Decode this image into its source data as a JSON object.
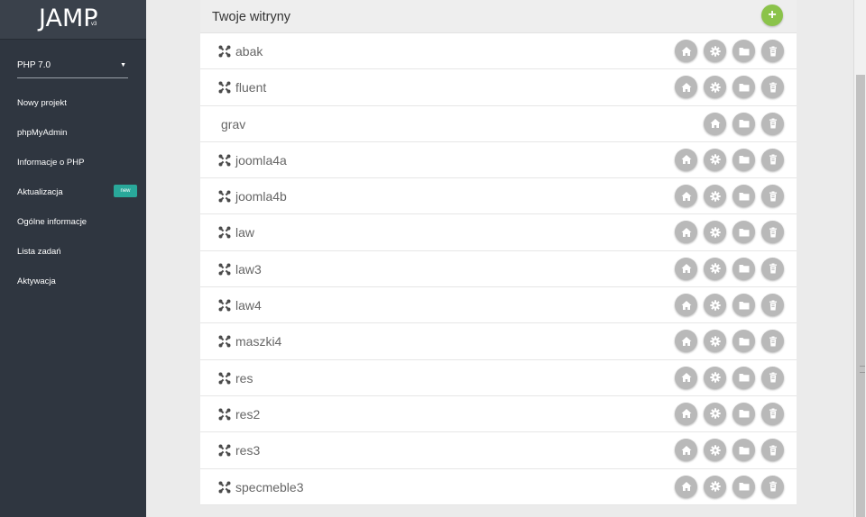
{
  "app": {
    "logo": "JAMP",
    "version": "v3"
  },
  "sidebar": {
    "php_select": {
      "value": "PHP 7.0",
      "arrow": "▼"
    },
    "items": [
      {
        "label": "Nowy projekt",
        "badge": null
      },
      {
        "label": "phpMyAdmin",
        "badge": null
      },
      {
        "label": "Informacje o PHP",
        "badge": null
      },
      {
        "label": "Aktualizacja",
        "badge": "new"
      },
      {
        "label": "Ogólne informacje",
        "badge": null
      },
      {
        "label": "Lista zadań",
        "badge": null
      },
      {
        "label": "Aktywacja",
        "badge": null
      }
    ]
  },
  "panel": {
    "title": "Twoje witryny",
    "add_label": "+",
    "sites": [
      {
        "name": "abak",
        "joomla": true,
        "settings": true
      },
      {
        "name": "fluent",
        "joomla": true,
        "settings": true
      },
      {
        "name": "grav",
        "joomla": false,
        "settings": false
      },
      {
        "name": "joomla4a",
        "joomla": true,
        "settings": true
      },
      {
        "name": "joomla4b",
        "joomla": true,
        "settings": true
      },
      {
        "name": "law",
        "joomla": true,
        "settings": true
      },
      {
        "name": "law3",
        "joomla": true,
        "settings": true
      },
      {
        "name": "law4",
        "joomla": true,
        "settings": true
      },
      {
        "name": "maszki4",
        "joomla": true,
        "settings": true
      },
      {
        "name": "res",
        "joomla": true,
        "settings": true
      },
      {
        "name": "res2",
        "joomla": true,
        "settings": true
      },
      {
        "name": "res3",
        "joomla": true,
        "settings": true
      },
      {
        "name": "specmeble3",
        "joomla": true,
        "settings": true
      }
    ]
  },
  "icons": {
    "site": "joomla-icon",
    "home": "home-icon",
    "settings": "gear-icon",
    "folder": "folder-icon",
    "delete": "trash-icon"
  },
  "colors": {
    "sidebar": "#2f3640",
    "accent_green": "#8bc34a",
    "badge": "#29a89a",
    "action_button": "#b9b9b9"
  }
}
